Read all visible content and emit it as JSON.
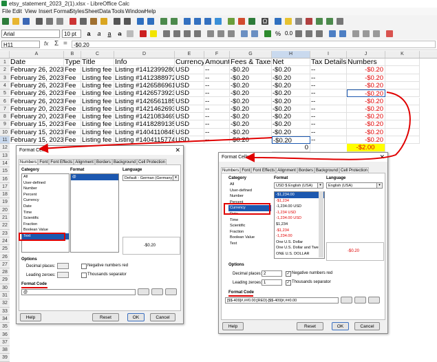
{
  "window": {
    "title": "etsy_statement_2023_2(1).xlsx - LibreOffice Calc"
  },
  "menu": [
    "File",
    "Edit",
    "View",
    "Insert",
    "Format",
    "Styles",
    "Sheet",
    "Data",
    "Tools",
    "Window",
    "Help"
  ],
  "toolbar": {
    "font_name": "Arial",
    "font_size": "10 pt"
  },
  "formula_bar": {
    "cell_ref": "H11",
    "content": "-$0.20",
    "fx": "fx",
    "sigma": "Σ",
    "equals": "="
  },
  "grid": {
    "columns": [
      "A",
      "B",
      "C",
      "D",
      "E",
      "F",
      "G",
      "H",
      "I",
      "J",
      "K"
    ],
    "headers": [
      "Date",
      "Type",
      "Title",
      "Info",
      "Currency",
      "Amount",
      "Fees & Taxes",
      "Net",
      "Tax Details",
      "Numbers"
    ],
    "rows": [
      {
        "num": "2",
        "date": "February 26, 2023",
        "type": "Fee",
        "title": "Listing fee",
        "info": "Listing #1412399280",
        "currency": "USD",
        "amount": "--",
        "fees": "-$0.20",
        "net": "-$0.20",
        "tax": "--",
        "numbers": "-$0.20"
      },
      {
        "num": "3",
        "date": "February 26, 2023",
        "type": "Fee",
        "title": "Listing fee",
        "info": "Listing #1412388972",
        "currency": "USD",
        "amount": "--",
        "fees": "-$0.20",
        "net": "-$0.20",
        "tax": "--",
        "numbers": "-$0.20"
      },
      {
        "num": "4",
        "date": "February 26, 2023",
        "type": "Fee",
        "title": "Listing fee",
        "info": "Listing #1426586961",
        "currency": "USD",
        "amount": "--",
        "fees": "-$0.20",
        "net": "-$0.20",
        "tax": "--",
        "numbers": "-$0.20"
      },
      {
        "num": "5",
        "date": "February 26, 2023",
        "type": "Fee",
        "title": "Listing fee",
        "info": "Listing #1426573923",
        "currency": "USD",
        "amount": "--",
        "fees": "-$0.20",
        "net": "-$0.20",
        "tax": "--",
        "numbers": "-$0.20"
      },
      {
        "num": "6",
        "date": "February 26, 2023",
        "type": "Fee",
        "title": "Listing fee",
        "info": "Listing #1426561185",
        "currency": "USD",
        "amount": "--",
        "fees": "-$0.20",
        "net": "-$0.20",
        "tax": "--",
        "numbers": "-$0.20"
      },
      {
        "num": "7",
        "date": "February 20, 2023",
        "type": "Fee",
        "title": "Listing fee",
        "info": "Listing #1421462693",
        "currency": "USD",
        "amount": "--",
        "fees": "-$0.20",
        "net": "-$0.20",
        "tax": "--",
        "numbers": "-$0.20"
      },
      {
        "num": "8",
        "date": "February 20, 2023",
        "type": "Fee",
        "title": "Listing fee",
        "info": "Listing #1421083469",
        "currency": "USD",
        "amount": "--",
        "fees": "-$0.20",
        "net": "-$0.20",
        "tax": "--",
        "numbers": "-$0.20"
      },
      {
        "num": "9",
        "date": "February 15, 2023",
        "type": "Fee",
        "title": "Listing fee",
        "info": "Listing #1418289135",
        "currency": "USD",
        "amount": "--",
        "fees": "-$0.20",
        "net": "-$0.20",
        "tax": "--",
        "numbers": "-$0.20"
      },
      {
        "num": "10",
        "date": "February 15, 2023",
        "type": "Fee",
        "title": "Listing fee",
        "info": "Listing #1404110848",
        "currency": "USD",
        "amount": "--",
        "fees": "-$0.20",
        "net": "-$0.20",
        "tax": "--",
        "numbers": "-$0.20"
      },
      {
        "num": "11",
        "date": "February 15, 2023",
        "type": "Fee",
        "title": "Listing fee",
        "info": "Listing #1404115774",
        "currency": "USD",
        "amount": "--",
        "fees": "-$0.20",
        "net": "-$0.20",
        "tax": "--",
        "numbers": "-$0.20"
      }
    ],
    "row12": {
      "num": "12",
      "net": "0",
      "numbers": "-$2.00"
    },
    "extra_rows": [
      "13",
      "14",
      "15",
      "16",
      "17",
      "18",
      "19",
      "20",
      "21",
      "22",
      "23",
      "24",
      "25",
      "26",
      "27",
      "28",
      "29",
      "30",
      "31",
      "32",
      "33",
      "34",
      "35",
      "36",
      "37",
      "38",
      "39"
    ]
  },
  "dialog_left": {
    "title": "Format Cells",
    "tabs": [
      "Numbers",
      "Font",
      "Font Effects",
      "Alignment",
      "Borders",
      "Background",
      "Cell Protection"
    ],
    "category_label": "Category",
    "categories": [
      "All",
      "User-defined",
      "Number",
      "Percent",
      "Currency",
      "Date",
      "Time",
      "Scientific",
      "Fraction",
      "Boolean Value",
      "Text"
    ],
    "selected_category": "Text",
    "format_label": "Format",
    "formats": [
      "@"
    ],
    "language_label": "Language",
    "language": "Default - German (Germany)",
    "preview": "-$0.20",
    "options_label": "Options",
    "decimal_label": "Decimal places:",
    "leading_label": "Leading zeroes:",
    "neg_red_label": "Negative numbers red",
    "thousands_label": "Thousands separator",
    "format_code_label": "Format Code",
    "format_code": "@",
    "buttons": {
      "help": "Help",
      "reset": "Reset",
      "ok": "OK",
      "cancel": "Cancel"
    }
  },
  "dialog_right": {
    "title": "Format Cells",
    "tabs": [
      "Numbers",
      "Font",
      "Font Effects",
      "Alignment",
      "Borders",
      "Background",
      "Cell Protection"
    ],
    "category_label": "Category",
    "categories": [
      "All",
      "User-defined",
      "Number",
      "Percent",
      "Currency",
      "Date",
      "Time",
      "Scientific",
      "Fraction",
      "Boolean Value",
      "Text"
    ],
    "selected_category": "Currency",
    "format_label": "Format",
    "format_combo": "USD $ English (USA)",
    "formats": [
      "-$1,234.00",
      "-$1,234",
      "-1,234.00 USD",
      "-1,234 USD",
      "-1,234.00 USD",
      "$1,234",
      "-$1,234",
      "-1,234.00",
      "One U.S. Dollar",
      "One U.S. Dollar and Twe",
      "ONE U.S. DOLLAR"
    ],
    "language_label": "Language",
    "language": "English (USA)",
    "preview": "-$0.20",
    "options_label": "Options",
    "decimal_label": "Decimal places:",
    "decimal_value": "2",
    "leading_label": "Leading zeroes:",
    "leading_value": "1",
    "neg_red_label": "Negative numbers red",
    "thousands_label": "Thousands separator",
    "format_code_label": "Format Code",
    "format_code": "[$$-409]#,##0.00;[RED]-[$$-409]#,##0.00",
    "buttons": {
      "help": "Help",
      "reset": "Reset",
      "ok": "OK",
      "cancel": "Cancel"
    }
  },
  "colors": {
    "accent_red": "#e00000",
    "selection_blue": "#1c58b0",
    "highlight_yellow": "#ffff00"
  }
}
